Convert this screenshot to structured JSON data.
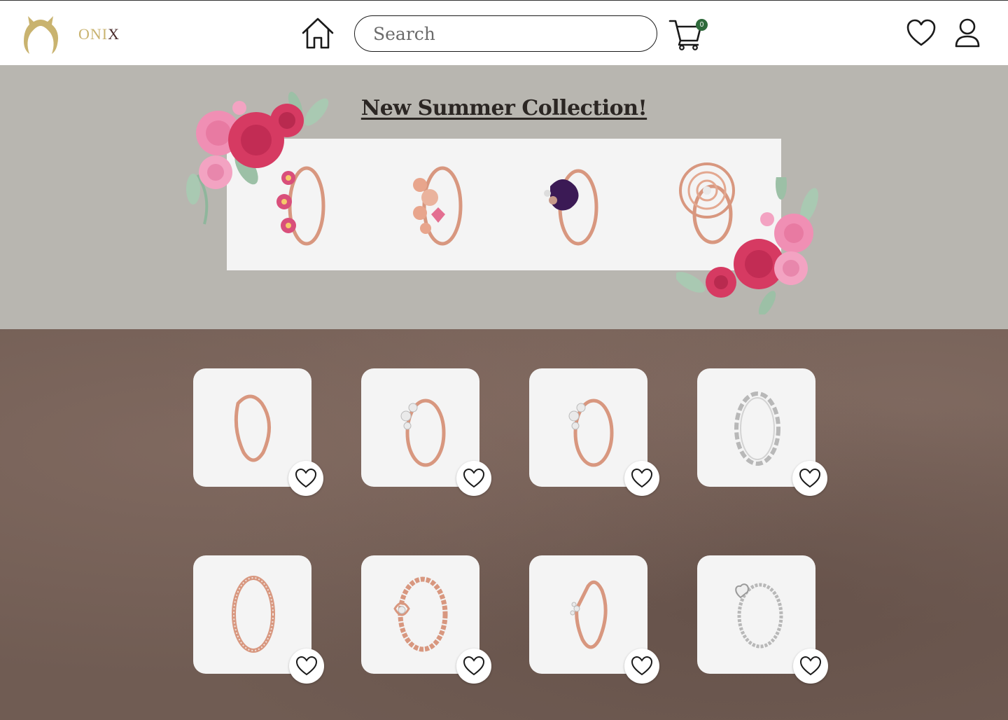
{
  "header": {
    "brand_part1": "ONI",
    "brand_part2": "X",
    "search_placeholder": "Search",
    "cart_count": "0",
    "icons": [
      "logo-icon",
      "home-icon",
      "cart-icon",
      "heart-icon",
      "user-icon"
    ]
  },
  "banner": {
    "title": "New Summer Collection!",
    "rings": [
      "pink-daisy-ring",
      "flower-heart-ring",
      "purple-pansy-ring",
      "rose-openwork-ring"
    ]
  },
  "products": [
    {
      "ring": "rose-gold-wishbone-ring",
      "favorited": false
    },
    {
      "ring": "rose-gold-tiara-ring",
      "favorited": false
    },
    {
      "ring": "rose-gold-tiara-ring",
      "favorited": false
    },
    {
      "ring": "silver-braided-ring",
      "favorited": false
    },
    {
      "ring": "rose-gold-pave-band",
      "favorited": false
    },
    {
      "ring": "rose-gold-beaded-crown-ring",
      "favorited": false
    },
    {
      "ring": "rose-gold-sparkle-wishbone-ring",
      "favorited": false
    },
    {
      "ring": "silver-heart-solitaire-ring",
      "favorited": false
    }
  ],
  "colors": {
    "brand_gold": "#c9b36f",
    "brand_dark": "#4a2b2b",
    "banner_bg": "#b8b6b0",
    "badge": "#2f6a3b",
    "rose_gold": "#d8977f",
    "silver": "#b8b8b8"
  }
}
